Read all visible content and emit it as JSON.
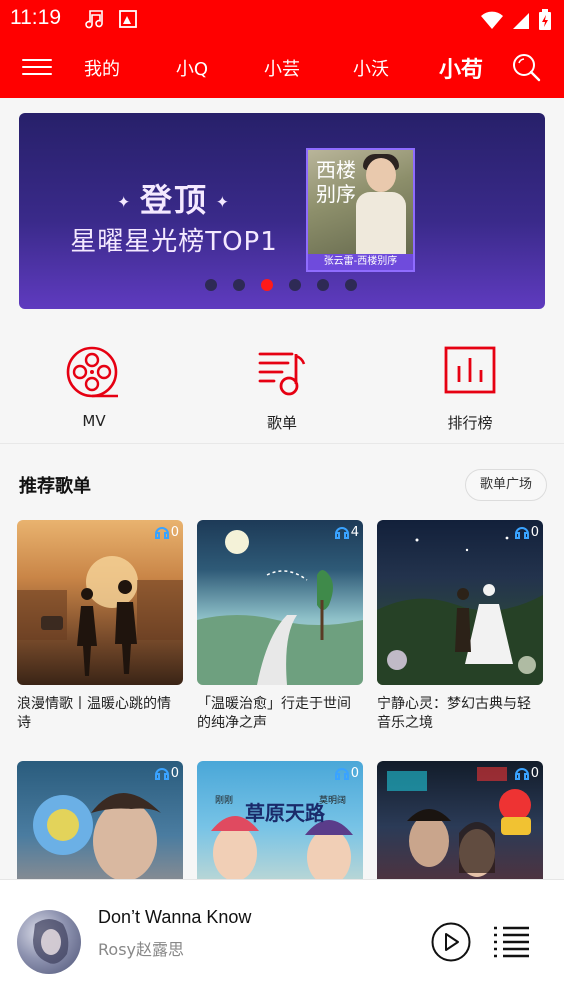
{
  "status": {
    "time": "11:19"
  },
  "nav": {
    "tabs": [
      {
        "label": "我的",
        "active": false
      },
      {
        "label": "小Q",
        "active": false
      },
      {
        "label": "小芸",
        "active": false
      },
      {
        "label": "小沃",
        "active": false
      },
      {
        "label": "小苟",
        "active": true
      }
    ]
  },
  "banner": {
    "title": "登顶",
    "subtitle": "星曜星光榜TOP1",
    "cover_text": "西楼别序",
    "cover_caption": "张云雷-西楼别序",
    "dots": 6,
    "active_dot": 3
  },
  "quick": [
    {
      "label": "MV",
      "icon": "film-reel-icon"
    },
    {
      "label": "歌单",
      "icon": "playlist-note-icon"
    },
    {
      "label": "排行榜",
      "icon": "chart-bars-icon"
    }
  ],
  "section": {
    "title": "推荐歌单",
    "more": "歌单广场"
  },
  "playlists": [
    {
      "title": "浪漫情歌丨温暖心跳的情诗",
      "count": "0"
    },
    {
      "title": "「温暖治愈」行走于世间的纯净之声",
      "count": "4"
    },
    {
      "title": "宁静心灵：梦幻古典与轻音乐之境",
      "count": "0"
    },
    {
      "title": "",
      "count": "0"
    },
    {
      "title": "",
      "count": "0"
    },
    {
      "title": "",
      "count": "0"
    }
  ],
  "card5_art": {
    "left": "刚刚",
    "mid": "草原天路",
    "right": "莫明阔"
  },
  "player": {
    "song": "Don’t Wanna Know",
    "artist": "Rosy赵露思"
  },
  "colors": {
    "brand": "#ff0000"
  }
}
